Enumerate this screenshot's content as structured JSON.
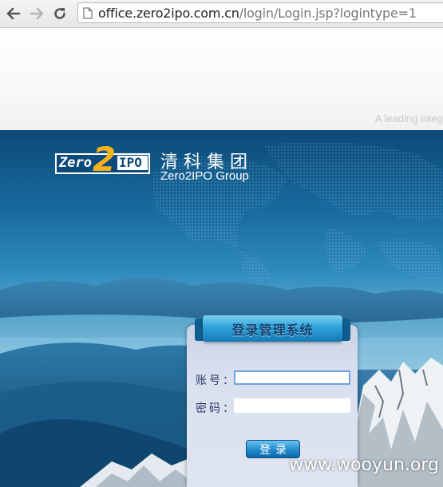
{
  "browser": {
    "url_host": "office.zero2ipo.com.cn",
    "url_path": "/login/Login.jsp?logintype=1",
    "back_icon": "back-arrow-icon",
    "forward_icon": "forward-arrow-icon",
    "reload_icon": "reload-icon",
    "page_icon": "page-icon"
  },
  "page": {
    "tagline": "A leading integ"
  },
  "brand": {
    "logo_zero": "Zero",
    "logo_two": "2",
    "logo_ipo": "IPO",
    "name_cn": "清科集团",
    "name_en": "Zero2IPO Group",
    "accent_color": "#f5b21d",
    "brand_blue": "#0d4a7c"
  },
  "login": {
    "title": "登录管理系统",
    "account_label": "账号：",
    "password_label": "密码：",
    "account_value": "",
    "password_value": "",
    "submit_label": "登录"
  },
  "watermark": "www.wooyun.org"
}
